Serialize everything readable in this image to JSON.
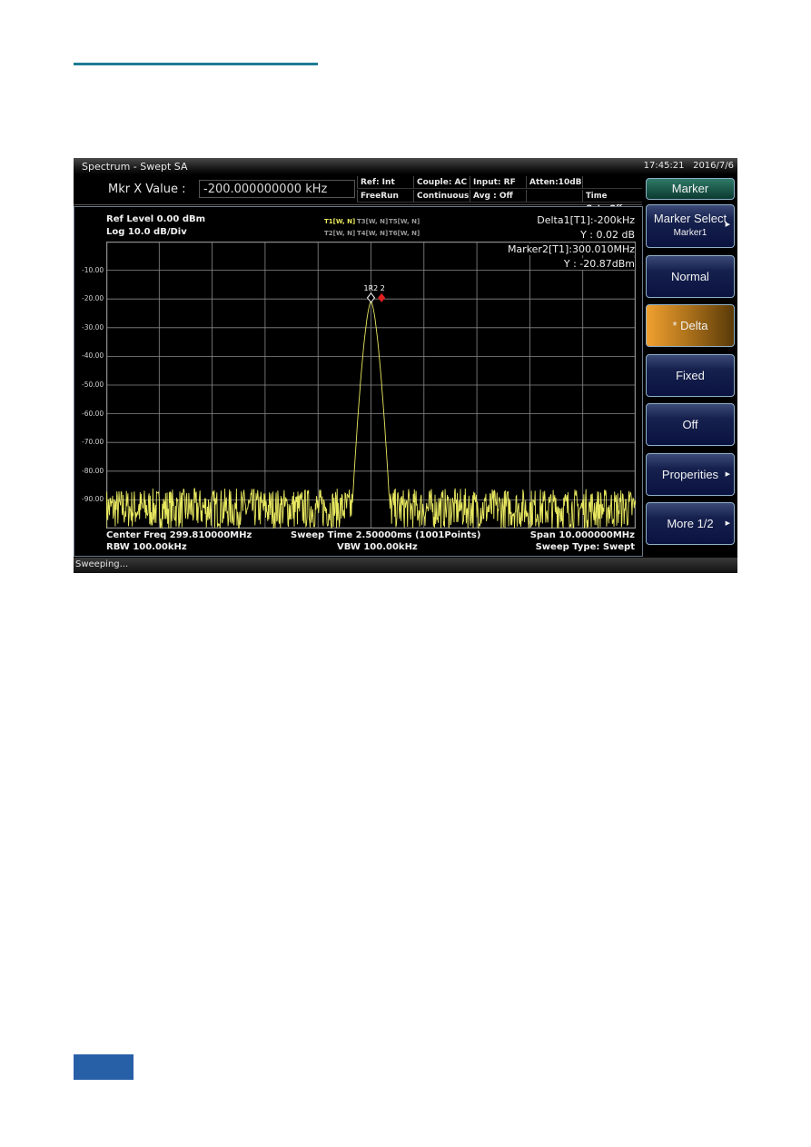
{
  "window": {
    "title": "Spectrum - Swept SA",
    "time": "17:45:21",
    "date": "2016/7/6"
  },
  "marker_entry": {
    "label": "Mkr X Value :",
    "value": "-200.000000000 kHz"
  },
  "status_fields": {
    "ref": "Ref: Int",
    "trigger": "FreeRun",
    "couple": "Couple: AC",
    "sweep_mode": "Continuous",
    "input": "Input: RF",
    "avg": "Avg : Off",
    "atten": "Atten:10dB",
    "time_gate": "Time Gate:Off"
  },
  "plot_header": {
    "ref_level": "Ref Level 0.00 dBm",
    "scale": "Log 10.0 dB/Div",
    "traces": [
      "T1[W, N]",
      "T3[W, N]",
      "T5[W, N]",
      "T2[W, N]",
      "T4[W, N]",
      "T6[W, N]"
    ],
    "active_trace": "T1[W, N]",
    "delta_readout": "Delta1[T1]:-200kHz",
    "delta_y": "Y : 0.02 dB",
    "marker2_readout": "Marker2[T1]:300.010MHz",
    "marker2_y": "Y : -20.87dBm",
    "marker_tag": "1R2 2"
  },
  "plot_footer": {
    "center_freq": "Center Freq 299.810000MHz",
    "rbw": "RBW 100.00kHz",
    "sweep_time": "Sweep Time 2.50000ms (1001Points)",
    "vbw": "VBW 100.00kHz",
    "span": "Span 10.000000MHz",
    "sweep_type": "Sweep Type: Swept"
  },
  "status_bar": "Sweeping...",
  "softkeys": {
    "menu_title": "Marker",
    "items": [
      {
        "label": "Marker Select",
        "sub": "Marker1",
        "arrow": true,
        "active": false
      },
      {
        "label": "Normal",
        "arrow": false,
        "active": false
      },
      {
        "label": "* Delta",
        "arrow": false,
        "active": true
      },
      {
        "label": "Fixed",
        "arrow": false,
        "active": false
      },
      {
        "label": "Off",
        "arrow": false,
        "active": false
      },
      {
        "label": "Properities",
        "arrow": true,
        "active": false
      },
      {
        "label": "More 1/2",
        "arrow": true,
        "active": false
      }
    ]
  },
  "colors": {
    "trace": "#e8e860",
    "grid": "#8a8a8a",
    "marker_delta": "#e02020",
    "marker_ref": "#ffffff",
    "active_key": "#f0a030"
  },
  "chart_data": {
    "type": "line",
    "title": "",
    "xlabel": "",
    "ylabel": "dBm",
    "x_center_mhz": 299.81,
    "x_span_mhz": 10.0,
    "xlim_mhz": [
      294.81,
      304.81
    ],
    "ylim": [
      -100,
      0
    ],
    "y_ticks": [
      "-10.00",
      "-20.00",
      "-30.00",
      "-40.00",
      "-50.00",
      "-60.00",
      "-70.00",
      "-80.00",
      "-90.00"
    ],
    "y_tick_values": [
      -10,
      -20,
      -30,
      -40,
      -50,
      -60,
      -70,
      -80,
      -90
    ],
    "grid": true,
    "x_divisions": 10,
    "y_divisions": 10,
    "series": [
      {
        "name": "T1",
        "description": "noise floor ~ -92 dBm (range -100 to -85) with single peak at center",
        "peak_freq_mhz": 299.81,
        "peak_dbm": -20.85,
        "noise_floor_dbm": -92
      }
    ],
    "markers": [
      {
        "name": "1R",
        "type": "delta-reference",
        "freq_mhz": 300.01,
        "dbm": -20.87
      },
      {
        "name": "2",
        "type": "normal",
        "freq_mhz": 300.01,
        "dbm": -20.87
      },
      {
        "name": "Delta1",
        "delta_khz": -200,
        "delta_db": 0.02
      }
    ]
  }
}
